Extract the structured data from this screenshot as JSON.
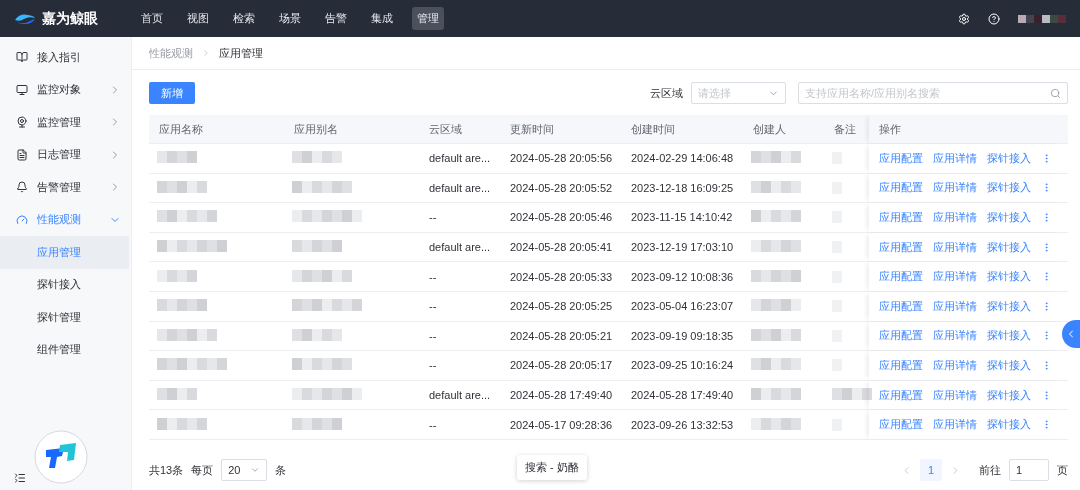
{
  "topbar": {
    "brand": "嘉为鲸眼",
    "nav": [
      {
        "label": "首页",
        "selected": false
      },
      {
        "label": "视图",
        "selected": false
      },
      {
        "label": "检索",
        "selected": false
      },
      {
        "label": "场景",
        "selected": false
      },
      {
        "label": "告警",
        "selected": false
      },
      {
        "label": "集成",
        "selected": false
      },
      {
        "label": "管理",
        "selected": true
      }
    ]
  },
  "sidebar": {
    "items": [
      {
        "label": "接入指引",
        "kind": "link",
        "selected": false
      },
      {
        "label": "监控对象",
        "kind": "group",
        "expanded": false,
        "selected": false
      },
      {
        "label": "监控管理",
        "kind": "group",
        "expanded": false,
        "selected": false
      },
      {
        "label": "日志管理",
        "kind": "group",
        "expanded": false,
        "selected": false
      },
      {
        "label": "告警管理",
        "kind": "group",
        "expanded": false,
        "selected": false
      },
      {
        "label": "性能观测",
        "kind": "group",
        "expanded": true,
        "selected": true,
        "children": [
          {
            "label": "应用管理",
            "selected": true
          },
          {
            "label": "探针接入",
            "selected": false
          },
          {
            "label": "探针管理",
            "selected": false
          },
          {
            "label": "组件管理",
            "selected": false
          }
        ]
      }
    ]
  },
  "breadcrumb": [
    "性能观测",
    "应用管理"
  ],
  "toolbar": {
    "add_button": "新增",
    "region_label": "云区域",
    "region_select": {
      "placeholder": "请选择"
    },
    "search": {
      "placeholder": "支持应用名称/应用别名搜索"
    }
  },
  "table": {
    "columns": [
      "应用名称",
      "应用别名",
      "云区域",
      "更新时间",
      "创建时间",
      "创建人",
      "备注",
      "操作"
    ],
    "rows": [
      {
        "region": "default are...",
        "updated": "2024-05-28 20:05:56",
        "created": "2024-02-29 14:06:48",
        "has_note": false,
        "actions": [
          "应用配置",
          "应用详情",
          "探针接入"
        ]
      },
      {
        "region": "default are...",
        "updated": "2024-05-28 20:05:52",
        "created": "2023-12-18 16:09:25",
        "has_note": false,
        "actions": [
          "应用配置",
          "应用详情",
          "探针接入"
        ]
      },
      {
        "region": "--",
        "updated": "2024-05-28 20:05:46",
        "created": "2023-11-15 14:10:42",
        "has_note": false,
        "actions": [
          "应用配置",
          "应用详情",
          "探针接入"
        ]
      },
      {
        "region": "default are...",
        "updated": "2024-05-28 20:05:41",
        "created": "2023-12-19 17:03:10",
        "has_note": false,
        "actions": [
          "应用配置",
          "应用详情",
          "探针接入"
        ]
      },
      {
        "region": "--",
        "updated": "2024-05-28 20:05:33",
        "created": "2023-09-12 10:08:36",
        "has_note": false,
        "actions": [
          "应用配置",
          "应用详情",
          "探针接入"
        ]
      },
      {
        "region": "--",
        "updated": "2024-05-28 20:05:25",
        "created": "2023-05-04 16:23:07",
        "has_note": false,
        "actions": [
          "应用配置",
          "应用详情",
          "探针接入"
        ]
      },
      {
        "region": "--",
        "updated": "2024-05-28 20:05:21",
        "created": "2023-09-19 09:18:35",
        "has_note": false,
        "actions": [
          "应用配置",
          "应用详情",
          "探针接入"
        ]
      },
      {
        "region": "--",
        "updated": "2024-05-28 20:05:17",
        "created": "2023-09-25 10:16:24",
        "has_note": false,
        "actions": [
          "应用配置",
          "应用详情",
          "探针接入"
        ]
      },
      {
        "region": "default are...",
        "updated": "2024-05-28 17:49:40",
        "created": "2024-05-28 17:49:40",
        "has_note": true,
        "actions": [
          "应用配置",
          "应用详情",
          "探针接入"
        ]
      },
      {
        "region": "--",
        "updated": "2024-05-17 09:28:36",
        "created": "2023-09-26 13:32:53",
        "has_note": false,
        "actions": [
          "应用配置",
          "应用详情",
          "探针接入"
        ]
      }
    ]
  },
  "footer": {
    "total": "共13条",
    "per_page_label": "每页",
    "per_page": "20",
    "per_page_unit": "条",
    "pages": [
      {
        "label": "1",
        "selected": true
      }
    ],
    "goto_label": "前往",
    "goto_value": "1",
    "goto_unit": "页"
  },
  "tooltip": "搜索 - 奶酪"
}
